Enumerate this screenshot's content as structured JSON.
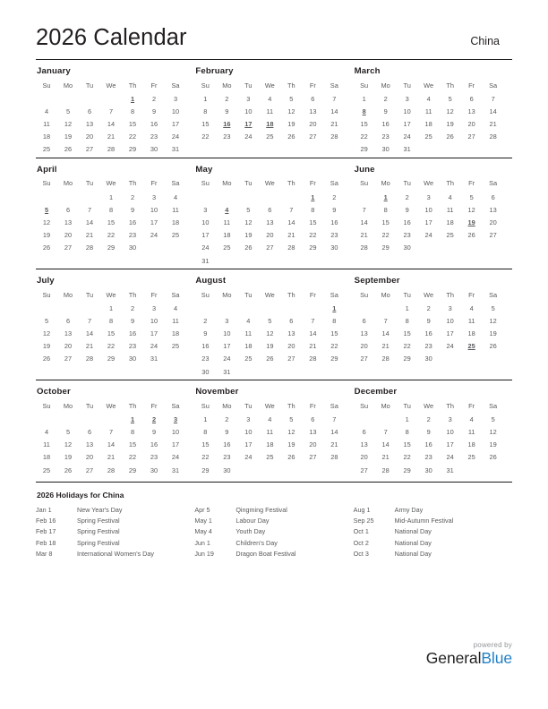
{
  "header": {
    "title": "2026 Calendar",
    "region": "China"
  },
  "weekday_headers": [
    "Su",
    "Mo",
    "Tu",
    "We",
    "Th",
    "Fr",
    "Sa"
  ],
  "holiday_color": "#ee1c25",
  "months": [
    {
      "name": "January",
      "lead_blanks": 4,
      "days": 31,
      "holidays": [
        1
      ]
    },
    {
      "name": "February",
      "lead_blanks": 0,
      "days": 28,
      "holidays": [
        16,
        17,
        18
      ]
    },
    {
      "name": "March",
      "lead_blanks": 0,
      "days": 31,
      "holidays": [
        8
      ]
    },
    {
      "name": "April",
      "lead_blanks": 3,
      "days": 30,
      "holidays": [
        5
      ]
    },
    {
      "name": "May",
      "lead_blanks": 5,
      "days": 31,
      "holidays": [
        1,
        4
      ]
    },
    {
      "name": "June",
      "lead_blanks": 1,
      "days": 30,
      "holidays": [
        1,
        19
      ]
    },
    {
      "name": "July",
      "lead_blanks": 3,
      "days": 31,
      "holidays": []
    },
    {
      "name": "August",
      "lead_blanks": 6,
      "days": 31,
      "holidays": [
        1
      ]
    },
    {
      "name": "September",
      "lead_blanks": 2,
      "days": 30,
      "holidays": [
        25
      ]
    },
    {
      "name": "October",
      "lead_blanks": 4,
      "days": 31,
      "holidays": [
        1,
        2,
        3
      ]
    },
    {
      "name": "November",
      "lead_blanks": 0,
      "days": 30,
      "holidays": []
    },
    {
      "name": "December",
      "lead_blanks": 2,
      "days": 31,
      "holidays": []
    }
  ],
  "holidays_section": {
    "title": "2026 Holidays for China",
    "columns": [
      [
        {
          "date": "Jan 1",
          "name": "New Year's Day"
        },
        {
          "date": "Feb 16",
          "name": "Spring Festival"
        },
        {
          "date": "Feb 17",
          "name": "Spring Festival"
        },
        {
          "date": "Feb 18",
          "name": "Spring Festival"
        },
        {
          "date": "Mar 8",
          "name": "International Women's Day"
        }
      ],
      [
        {
          "date": "Apr 5",
          "name": "Qingming Festival"
        },
        {
          "date": "May 1",
          "name": "Labour Day"
        },
        {
          "date": "May 4",
          "name": "Youth Day"
        },
        {
          "date": "Jun 1",
          "name": "Children's Day"
        },
        {
          "date": "Jun 19",
          "name": "Dragon Boat Festival"
        }
      ],
      [
        {
          "date": "Aug 1",
          "name": "Army Day"
        },
        {
          "date": "Sep 25",
          "name": "Mid-Autumn Festival"
        },
        {
          "date": "Oct 1",
          "name": "National Day"
        },
        {
          "date": "Oct 2",
          "name": "National Day"
        },
        {
          "date": "Oct 3",
          "name": "National Day"
        }
      ]
    ]
  },
  "footer": {
    "powered_by": "powered by",
    "brand_first": "General",
    "brand_second": "Blue",
    "brand_color": "#2581c4"
  }
}
